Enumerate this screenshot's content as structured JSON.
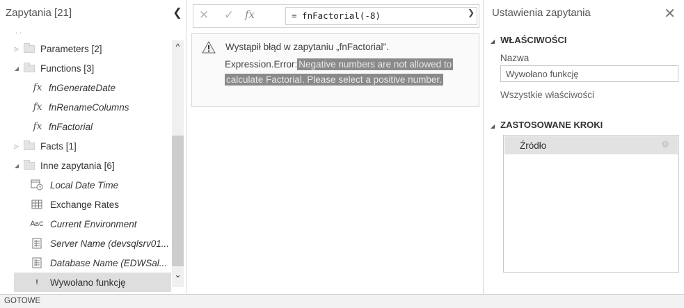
{
  "queries_panel": {
    "title": "Zapytania [21]",
    "collapse_icon": "chevron-left-icon",
    "items": [
      {
        "label": "Parameters [2]",
        "type": "folder",
        "expanded": false
      },
      {
        "label": "Functions [3]",
        "type": "folder",
        "expanded": true
      },
      {
        "label": "fnGenerateDate",
        "type": "function"
      },
      {
        "label": "fnRenameColumns",
        "type": "function"
      },
      {
        "label": "fnFactorial",
        "type": "function"
      },
      {
        "label": "Facts [1]",
        "type": "folder",
        "expanded": false
      },
      {
        "label": "Inne zapytania [6]",
        "type": "folder",
        "expanded": true
      },
      {
        "label": "Local Date Time",
        "type": "datetime-query"
      },
      {
        "label": "Exchange Rates",
        "type": "table-query"
      },
      {
        "label": "Current Environment",
        "type": "text-query"
      },
      {
        "label": "Server Name (devsqlsrv01...",
        "type": "parameter-query"
      },
      {
        "label": "Database Name (EDWSal...",
        "type": "parameter-query"
      },
      {
        "label": "Wywołano funkcję",
        "type": "error-query",
        "selected": true
      }
    ]
  },
  "formula_bar": {
    "formula": "= fnFactorial(-8)",
    "fx_label": "fx"
  },
  "error": {
    "title": "Wystąpił błąd w zapytaniu „fnFactorial”.",
    "prefix": "Expression.Error:",
    "message_line1": "Negative numbers are not allowed to",
    "message_line2": "calculate Factorial. Please select a positive number."
  },
  "settings": {
    "title": "Ustawienia zapytania",
    "properties_heading": "WŁAŚCIWOŚCI",
    "name_label": "Nazwa",
    "name_value": "Wywołano funkcję",
    "all_properties_link": "Wszystkie właściwości",
    "applied_steps_heading": "ZASTOSOWANE KROKI",
    "steps": [
      {
        "label": "Źródło"
      }
    ]
  },
  "status_bar": {
    "text": "GOTOWE"
  }
}
